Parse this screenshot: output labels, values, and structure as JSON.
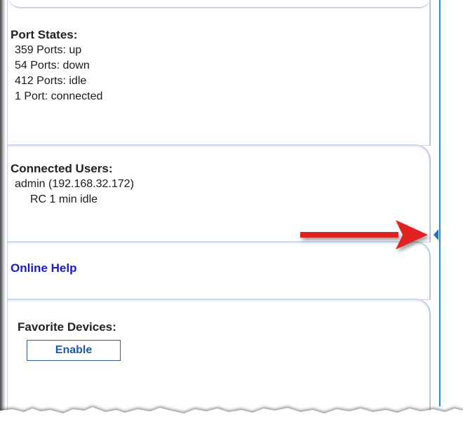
{
  "port_states": {
    "title": "Port States:",
    "lines": [
      "359 Ports: up",
      "54 Ports: down",
      "412 Ports: idle",
      "1 Port: connected"
    ]
  },
  "connected_users": {
    "title": "Connected Users:",
    "user": "admin (192.168.32.172)",
    "session": "RC 1 min idle"
  },
  "online_help": {
    "label": "Online Help"
  },
  "favorite_devices": {
    "title": "Favorite Devices:",
    "enable_label": "Enable"
  },
  "colors": {
    "splitter": "#2e8bd6",
    "annotation_arrow": "#e02020",
    "link": "#1a1acc",
    "panel_border": "#c7d3e6"
  },
  "icons": {
    "collapse_handle": "chevron-left-icon",
    "annotation": "red-arrow-icon"
  }
}
